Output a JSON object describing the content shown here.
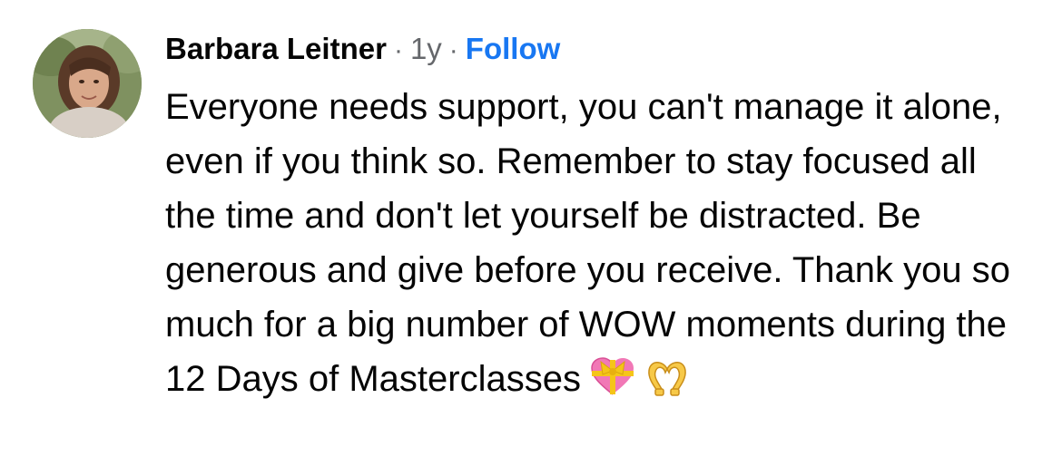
{
  "comment": {
    "author": "Barbara Leitner",
    "separator": "·",
    "time": "1y",
    "follow_label": "Follow",
    "body": "Everyone needs support, you can't manage it alone, even if you think so. Remember to stay focused all the time and don't let yourself be distracted. Be generous and give before you receive. Thank you so much for a big number of WOW moments during the 12 Days of Masterclasses",
    "emojis": [
      "heart-with-ribbon-icon",
      "heart-hands-icon"
    ]
  },
  "colors": {
    "author": "#050505",
    "meta": "#65676b",
    "link": "#1877f2",
    "text": "#050505"
  }
}
